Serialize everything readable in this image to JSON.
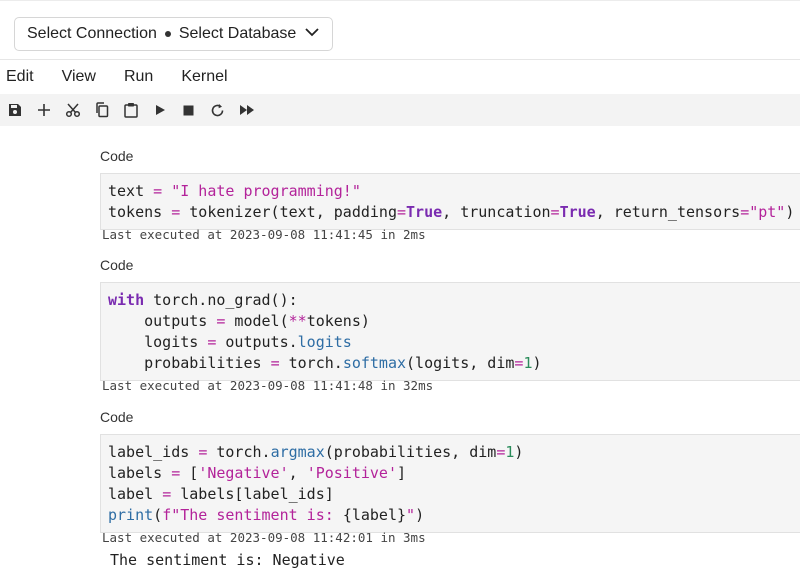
{
  "connection": {
    "connection_label": "Select Connection",
    "database_label": "Select Database"
  },
  "menu": [
    "Edit",
    "View",
    "Run",
    "Kernel"
  ],
  "toolbar": [
    {
      "icon": "save-icon"
    },
    {
      "icon": "add-icon"
    },
    {
      "icon": "cut-icon"
    },
    {
      "icon": "copy-icon"
    },
    {
      "icon": "paste-icon"
    },
    {
      "icon": "run-icon"
    },
    {
      "icon": "stop-icon"
    },
    {
      "icon": "restart-icon"
    },
    {
      "icon": "run-all-icon"
    }
  ],
  "cells": [
    {
      "label": "Code",
      "lines": [
        [
          {
            "t": "text "
          },
          {
            "t": "=",
            "c": "op"
          },
          {
            "t": " "
          },
          {
            "t": "\"I hate programming!\"",
            "c": "str"
          }
        ],
        [
          {
            "t": "tokens "
          },
          {
            "t": "=",
            "c": "op"
          },
          {
            "t": " tokenizer(text, padding"
          },
          {
            "t": "=",
            "c": "op"
          },
          {
            "t": "True",
            "c": "kw"
          },
          {
            "t": ", truncation"
          },
          {
            "t": "=",
            "c": "op"
          },
          {
            "t": "True",
            "c": "kw"
          },
          {
            "t": ", return_tensors"
          },
          {
            "t": "=",
            "c": "op"
          },
          {
            "t": "\"pt\"",
            "c": "str"
          },
          {
            "t": ")"
          }
        ]
      ],
      "meta": "Last executed at 2023-09-08 11:41:45 in 2ms"
    },
    {
      "label": "Code",
      "lines": [
        [
          {
            "t": "with",
            "c": "kw"
          },
          {
            "t": " torch.no_grad():"
          }
        ],
        [
          {
            "t": "    outputs "
          },
          {
            "t": "=",
            "c": "op"
          },
          {
            "t": " model("
          },
          {
            "t": "**",
            "c": "op"
          },
          {
            "t": "tokens)"
          }
        ],
        [
          {
            "t": "    logits "
          },
          {
            "t": "=",
            "c": "op"
          },
          {
            "t": " outputs."
          },
          {
            "t": "logits",
            "c": "fn"
          }
        ],
        [
          {
            "t": "    probabilities "
          },
          {
            "t": "=",
            "c": "op"
          },
          {
            "t": " torch."
          },
          {
            "t": "softmax",
            "c": "fn"
          },
          {
            "t": "(logits, dim"
          },
          {
            "t": "=",
            "c": "op"
          },
          {
            "t": "1",
            "c": "num"
          },
          {
            "t": ")"
          }
        ]
      ],
      "meta": "Last executed at 2023-09-08 11:41:48 in 32ms"
    },
    {
      "label": "Code",
      "lines": [
        [
          {
            "t": "label_ids "
          },
          {
            "t": "=",
            "c": "op"
          },
          {
            "t": " torch."
          },
          {
            "t": "argmax",
            "c": "fn"
          },
          {
            "t": "(probabilities, dim"
          },
          {
            "t": "=",
            "c": "op"
          },
          {
            "t": "1",
            "c": "num"
          },
          {
            "t": ")"
          }
        ],
        [
          {
            "t": "labels "
          },
          {
            "t": "=",
            "c": "op"
          },
          {
            "t": " ["
          },
          {
            "t": "'Negative'",
            "c": "str"
          },
          {
            "t": ", "
          },
          {
            "t": "'Positive'",
            "c": "str"
          },
          {
            "t": "]"
          }
        ],
        [
          {
            "t": "label "
          },
          {
            "t": "=",
            "c": "op"
          },
          {
            "t": " labels[label_ids]"
          }
        ],
        [
          {
            "t": "print",
            "c": "cst"
          },
          {
            "t": "("
          },
          {
            "t": "f\"The sentiment is: ",
            "c": "str"
          },
          {
            "t": "{label}"
          },
          {
            "t": "\"",
            "c": "str"
          },
          {
            "t": ")"
          }
        ]
      ],
      "meta": "Last executed at 2023-09-08 11:42:01 in 3ms",
      "output": "The sentiment is: Negative"
    }
  ]
}
